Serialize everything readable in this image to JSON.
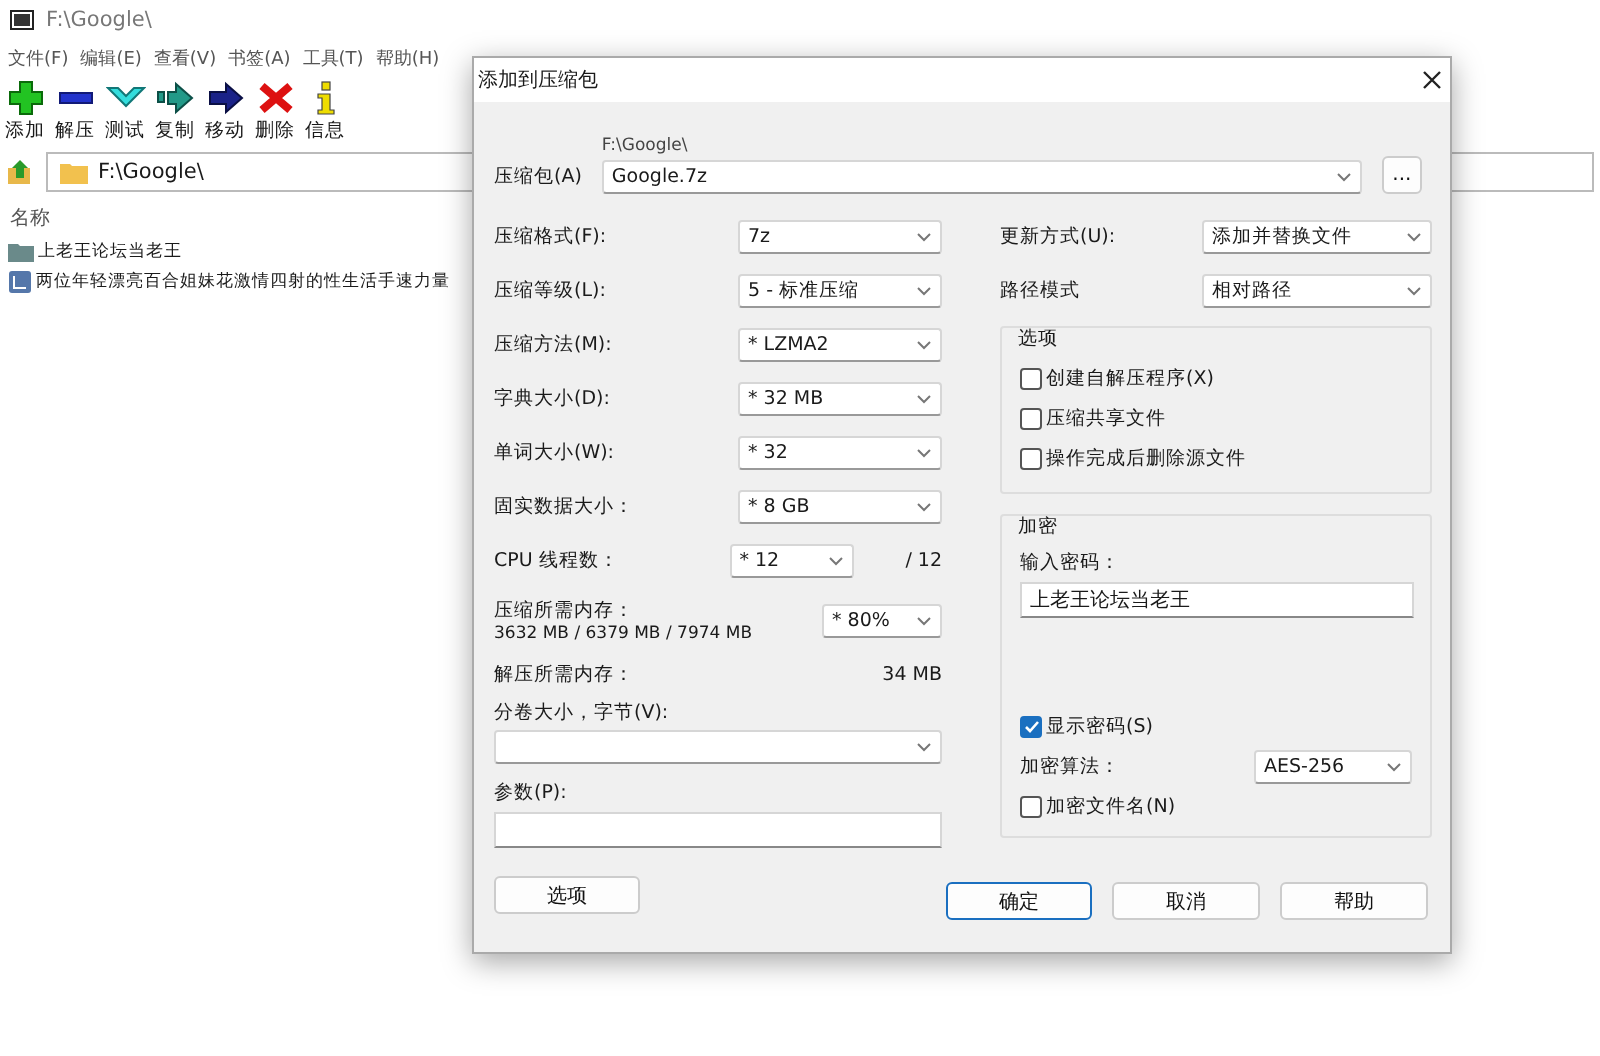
{
  "app": {
    "title": "F:\\Google\\",
    "menu": [
      "文件(F)",
      "编辑(E)",
      "查看(V)",
      "书签(A)",
      "工具(T)",
      "帮助(H)"
    ],
    "toolbar": [
      {
        "label": "添加",
        "kind": "add"
      },
      {
        "label": "解压",
        "kind": "extract"
      },
      {
        "label": "测试",
        "kind": "test"
      },
      {
        "label": "复制",
        "kind": "copy"
      },
      {
        "label": "移动",
        "kind": "move"
      },
      {
        "label": "删除",
        "kind": "delete"
      },
      {
        "label": "信息",
        "kind": "info"
      }
    ],
    "address": "F:\\Google\\",
    "column": "名称",
    "files": [
      {
        "name": "上老王论坛当老王",
        "kind": "folder"
      },
      {
        "name": "两位年轻漂亮百合姐妹花激情四射的性生活手速力量",
        "kind": "file"
      }
    ]
  },
  "dialog": {
    "title": "添加到压缩包",
    "archive_label": "压缩包(A)",
    "archive_dir": "F:\\Google\\",
    "archive_name": "Google.7z",
    "browse": "...",
    "settings": [
      {
        "kind": "select",
        "label": "压缩格式(F):",
        "value": "7z"
      },
      {
        "kind": "select",
        "label": "压缩等级(L):",
        "value": "5 - 标准压缩"
      },
      {
        "kind": "select",
        "label": "压缩方法(M):",
        "value": "* LZMA2"
      },
      {
        "kind": "select",
        "label": "字典大小(D):",
        "value": "* 32 MB"
      },
      {
        "kind": "select",
        "label": "单词大小(W):",
        "value": "* 32"
      },
      {
        "kind": "select",
        "label": "固实数据大小：",
        "value": "* 8 GB"
      },
      {
        "kind": "thread",
        "label": "CPU 线程数：",
        "value": "* 12",
        "suffix": "/ 12"
      },
      {
        "kind": "memory",
        "label": "压缩所需内存：",
        "detail": "3632 MB / 6379 MB / 7974 MB",
        "value": "* 80%"
      },
      {
        "kind": "readout",
        "label": "解压所需内存：",
        "value": "34 MB"
      }
    ],
    "volume": {
      "label": "分卷大小，字节(V):"
    },
    "params": {
      "label": "参数(P):"
    },
    "options_button": "选项",
    "update": {
      "label": "更新方式(U):",
      "value": "添加并替换文件"
    },
    "path_mode": {
      "label": "路径模式",
      "value": "相对路径"
    },
    "options": {
      "title": "选项",
      "items": [
        {
          "label": "创建自解压程序(X)",
          "checked": false
        },
        {
          "label": "压缩共享文件",
          "checked": false
        },
        {
          "label": "操作完成后删除源文件",
          "checked": false
        }
      ]
    },
    "encryption": {
      "title": "加密",
      "password_label": "输入密码：",
      "password": "上老王论坛当老王",
      "show_password": {
        "label": "显示密码(S)",
        "checked": true
      },
      "method_label": "加密算法：",
      "method": "AES-256",
      "encrypt_names": {
        "label": "加密文件名(N)",
        "checked": false
      }
    },
    "buttons": [
      "确定",
      "取消",
      "帮助"
    ]
  }
}
